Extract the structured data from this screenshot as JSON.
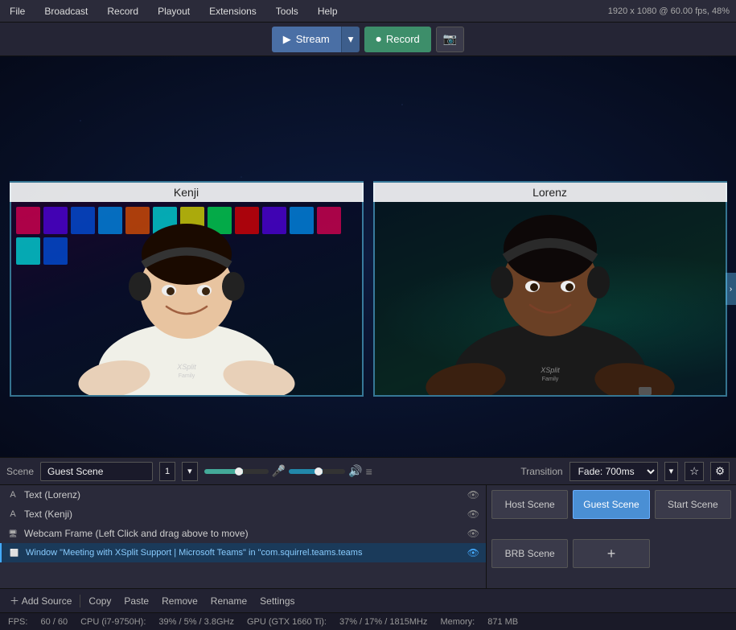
{
  "app": {
    "resolution": "1920 x 1080 @ 60.00 fps, 48%"
  },
  "menu": {
    "items": [
      "File",
      "Broadcast",
      "Record",
      "Playout",
      "Extensions",
      "Tools",
      "Help"
    ]
  },
  "toolbar": {
    "stream_label": "Stream",
    "record_label": "Record",
    "stream_icon": "▶",
    "record_icon": "⏺",
    "screenshot_icon": "📷"
  },
  "guests": [
    {
      "name": "Kenji",
      "id": "kenji"
    },
    {
      "name": "Lorenz",
      "id": "lorenz"
    }
  ],
  "scene": {
    "label": "Scene",
    "name": "Guest Scene",
    "number": "1",
    "transition_label": "Transition",
    "transition_value": "Fade: 700ms"
  },
  "sources": [
    {
      "type": "text",
      "name": "Text (Lorenz)",
      "visible": true
    },
    {
      "type": "text",
      "name": "Text (Kenji)",
      "visible": true
    },
    {
      "type": "webcam",
      "name": "Webcam Frame (Left Click and drag above to move)",
      "visible": true
    },
    {
      "type": "window",
      "name": "Window \"Meeting with XSplit Support | Microsoft Teams\" in \"com.squirrel.teams.teams",
      "visible": true,
      "selected": true
    }
  ],
  "source_actions": {
    "add": "Add Source",
    "copy": "Copy",
    "paste": "Paste",
    "remove": "Remove",
    "rename": "Rename",
    "settings": "Settings"
  },
  "scene_buttons": [
    {
      "label": "Host Scene",
      "active": false
    },
    {
      "label": "Guest Scene",
      "active": true
    },
    {
      "label": "Start Scene",
      "active": false
    },
    {
      "label": "BRB Scene",
      "active": false
    },
    {
      "label": "+",
      "is_add": true
    }
  ],
  "status_bar": {
    "fps_label": "FPS:",
    "fps_value": "60 / 60",
    "cpu_label": "CPU (i7-9750H):",
    "cpu_value": "39% / 5% / 3.8GHz",
    "gpu_label": "GPU (GTX 1660 Ti):",
    "gpu_value": "37% / 17% / 1815MHz",
    "memory_label": "Memory:",
    "memory_value": "871 MB"
  }
}
